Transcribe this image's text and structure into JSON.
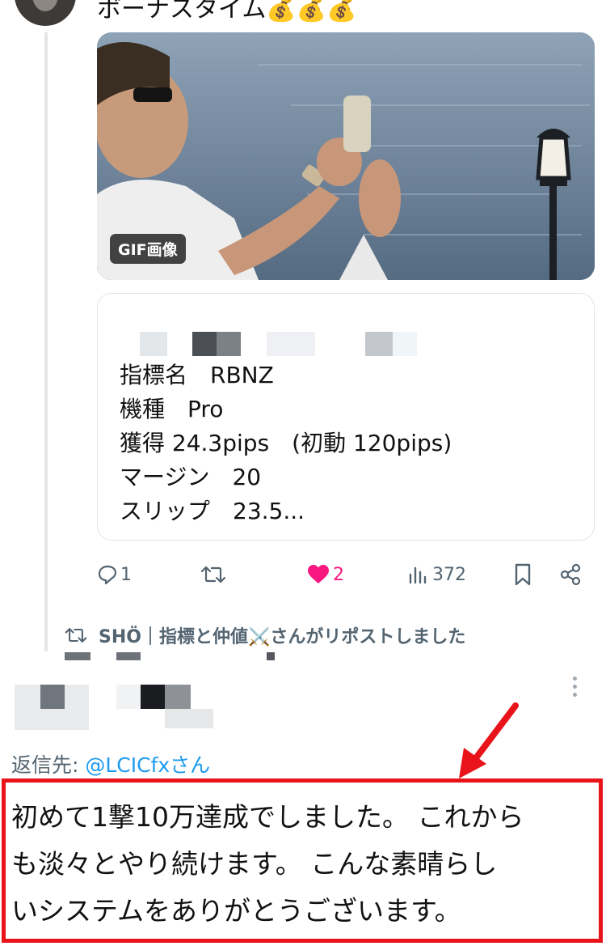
{
  "top_post": {
    "title": "ボーナスタイム💰💰💰",
    "gif_badge": "GIF画像"
  },
  "quote_card": {
    "lines": [
      "指標名　RBNZ",
      "機種　Pro",
      "獲得 24.3pips　(初動 120pips)",
      "マージン　20",
      "スリップ　23.5..."
    ]
  },
  "actions": {
    "reply_count": "1",
    "like_count": "2",
    "views_count": "372",
    "like_color": "#f91880"
  },
  "repost_notice": "SHÖ｜指標と仲値⚔️さんがリポストしました",
  "reply": {
    "label": "返信先: ",
    "handle": "@LCICfxさん",
    "body_lines": [
      "初めて1撃10万達成でしました。 これから",
      "も淡々とやり続けます。 こんな素晴らし",
      "いシステムをありがとうございます。"
    ]
  },
  "colors": {
    "highlight_border": "#e8141a",
    "link": "#1d9bf0",
    "muted": "#536471"
  }
}
